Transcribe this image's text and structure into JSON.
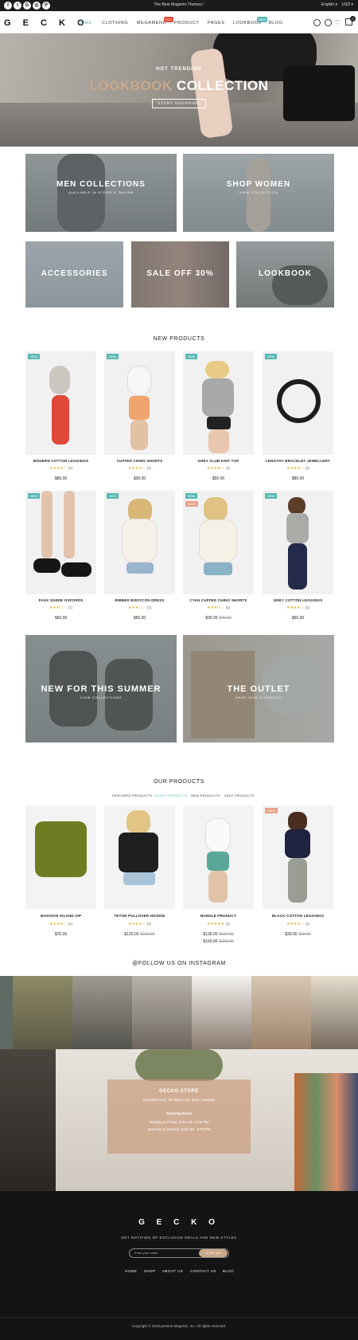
{
  "colors": {
    "accent": "#57b8b3",
    "sale": "#e7a287",
    "star": "#e4b43a",
    "store_overlay": "#c99874",
    "footer_bg": "#141414"
  },
  "topbar": {
    "social_icons": [
      "facebook-icon",
      "twitter-icon",
      "google-plus-icon",
      "instagram-icon",
      "pinterest-icon"
    ],
    "social_glyphs": [
      "f",
      "t",
      "G",
      "◎",
      "P"
    ],
    "message": "The Best Magento Themes !",
    "language": "English ▾",
    "currency": "USD ▾"
  },
  "header": {
    "logo": "G E C K O",
    "nav": [
      "HOME",
      "CLOTHING",
      "MEGAMENU",
      "PRODUCT",
      "PAGES",
      "LOOKBOOK",
      "BLOG"
    ],
    "badges": {
      "megamenu": "HOT",
      "lookbook": "NEW"
    },
    "cart_count": "0"
  },
  "hero": {
    "subtitle": "HOT TRENDING",
    "title_highlight": "LOOKBOOK",
    "title_rest": " COLLECTION",
    "button": "START SHOPPING"
  },
  "banners": {
    "men": {
      "title": "MEN COLLECTIONS",
      "sub": "AVAILABLE IN STORE & ONLINE"
    },
    "women": {
      "title": "SHOP WOMEN",
      "sub": "VIEW COLLECTION"
    },
    "accessories": {
      "title": "ACCESSORIES"
    },
    "sale": {
      "title": "SALE OFF 30%"
    },
    "lookbook": {
      "title": "LOOKBOOK"
    },
    "summer": {
      "title": "NEW FOR THIS SUMMER",
      "sub": "VIEW COLLECTIONS"
    },
    "outlet": {
      "title": "THE OUTLET",
      "sub": "SHOP OUR CLOSEOUT"
    }
  },
  "new_products": {
    "title": "NEW PRODUCTS",
    "items": [
      {
        "badge": "NEW",
        "name": "MODERN COTTON LEGGINGS",
        "stars": "★★★★☆",
        "count": "(1)",
        "price": "$80.00",
        "old": ""
      },
      {
        "badge": "NEW",
        "name": "CUFFED CHINO SHORTS",
        "stars": "★★★★☆",
        "count": "(1)",
        "price": "$30.00",
        "old": ""
      },
      {
        "badge": "NEW",
        "name": "GREY SLUB KNIT TOP",
        "stars": "★★★★☆",
        "count": "(1)",
        "price": "$50.00",
        "old": ""
      },
      {
        "badge": "NEW",
        "name": "LENGTHY BRACELET JEWELLERY",
        "stars": "★★★★☆",
        "count": "(1)",
        "price": "$80.00",
        "old": ""
      },
      {
        "badge": "NEW",
        "name": "FAUX SUEDE OXFORDS",
        "stars": "★★★☆☆",
        "count": "(1)",
        "price": "$60.00",
        "old": ""
      },
      {
        "badge": "NEW",
        "name": "RIBBED BODYCON DRESS",
        "stars": "★★★☆☆",
        "count": "(1)",
        "price": "$50.00",
        "old": ""
      },
      {
        "badge": "NEW",
        "badge2": "SALE",
        "name": "CYAN CUFFED CHINO SHORTS",
        "stars": "★★★☆☆",
        "count": "(1)",
        "price": "$30.00",
        "old": "$40.00"
      },
      {
        "badge": "NEW",
        "name": "GREY COTTON LEGGINGS",
        "stars": "★★★★☆",
        "count": "(1)",
        "price": "$60.00",
        "old": ""
      }
    ]
  },
  "our_products": {
    "title": "OUR PRODUCTS",
    "tabs": [
      "FEATURED PRODUCTS",
      "LATEST PRODUCTS",
      "NEW PRODUCTS",
      "SALE PRODUCTS"
    ],
    "items": [
      {
        "badge": "",
        "name": "MADISON ISLAND VIP",
        "stars": "★★★★☆",
        "count": "(1)",
        "price": "$70.00",
        "old": ""
      },
      {
        "badge": "",
        "name": "TETON PULLOVER HOODIE",
        "stars": "★★★★☆",
        "count": "(2)",
        "price": "$120.00",
        "old": "$130.00"
      },
      {
        "badge": "",
        "name": "BUNDLE PRODUCT",
        "stars": "★★★★★",
        "count": "(1)",
        "price": "$135.00",
        "old": "$164.00",
        "price2": "$160.00",
        "old2": "$200.00"
      },
      {
        "badge": "SALE",
        "name": "BLACK COTTON LEGGINGS",
        "stars": "★★★★☆",
        "count": "(1)",
        "price": "$30.00",
        "old": "$60.00"
      }
    ]
  },
  "instagram": {
    "title": "@FOLLOW US ON INSTAGRAM"
  },
  "store": {
    "name": "GECKO STORE",
    "address": "184 Main Rd E, St Albans VIC 3021, Australia",
    "hours_title": "Opening Hours",
    "weekday": "Monday to Friday: 9:00 AM - 9:00 PM",
    "weekend": "Saturday to Sunday: 9:30 AM - 8:00 PM"
  },
  "footer": {
    "logo": "G E C K O",
    "subscribe": "GET NOTIFIED OF EXCLUSIVE DEALS AND NEW STYLES",
    "email_placeholder": "Enter your email",
    "signup": "SIGN UP",
    "links": [
      "HOME",
      "SHOP",
      "ABOUT US",
      "CONTACT US",
      "BLOG"
    ],
    "copyright": "Copyright © 2019-present Magento, Inc. All rights reserved."
  }
}
